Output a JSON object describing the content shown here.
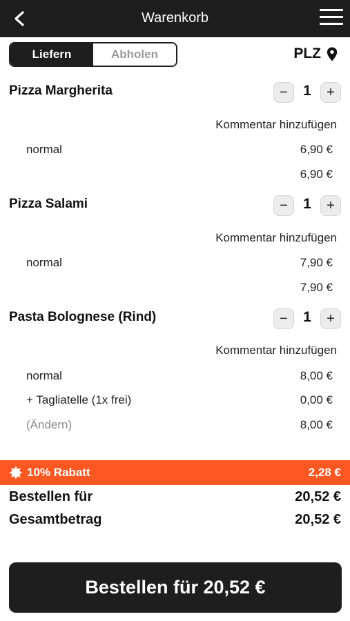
{
  "header": {
    "title": "Warenkorb",
    "back_icon": "chevron-left-icon",
    "menu_icon": "hamburger-menu-icon"
  },
  "delivery_toggle": {
    "options": [
      "Liefern",
      "Abholen"
    ],
    "selected": "Liefern"
  },
  "plz": {
    "label": "PLZ",
    "icon": "location-pin-icon"
  },
  "cart": {
    "items": [
      {
        "name": "Pizza Margherita",
        "quantity": "1",
        "comment_label": "Kommentar hinzufügen",
        "lines": [
          {
            "label": "normal",
            "price": "6,90 €"
          }
        ],
        "subtotal": "6,90 €"
      },
      {
        "name": "Pizza Salami",
        "quantity": "1",
        "comment_label": "Kommentar hinzufügen",
        "lines": [
          {
            "label": "normal",
            "price": "7,90 €"
          }
        ],
        "subtotal": "7,90 €"
      },
      {
        "name": "Pasta Bolognese (Rind)",
        "quantity": "1",
        "comment_label": "Kommentar hinzufügen",
        "lines": [
          {
            "label": "normal",
            "price": "8,00 €"
          },
          {
            "label": "+ Tagliatelle (1x frei)",
            "price": "0,00 €"
          }
        ],
        "change_label": "(Ändern)",
        "subtotal": "8,00 €"
      }
    ],
    "minus_symbol": "−",
    "plus_symbol": "+"
  },
  "discount": {
    "label": "10% Rabatt",
    "amount": "2,28 €",
    "icon": "badge-sun-icon",
    "color": "#ff5722"
  },
  "summary": {
    "order_for_label": "Bestellen für",
    "order_for_value": "20,52 €",
    "total_label": "Gesamtbetrag",
    "total_value": "20,52 €"
  },
  "order_button": {
    "label": "Bestellen für 20,52 €"
  },
  "colors": {
    "dark": "#1e1e1e",
    "accent": "#ff5722"
  }
}
